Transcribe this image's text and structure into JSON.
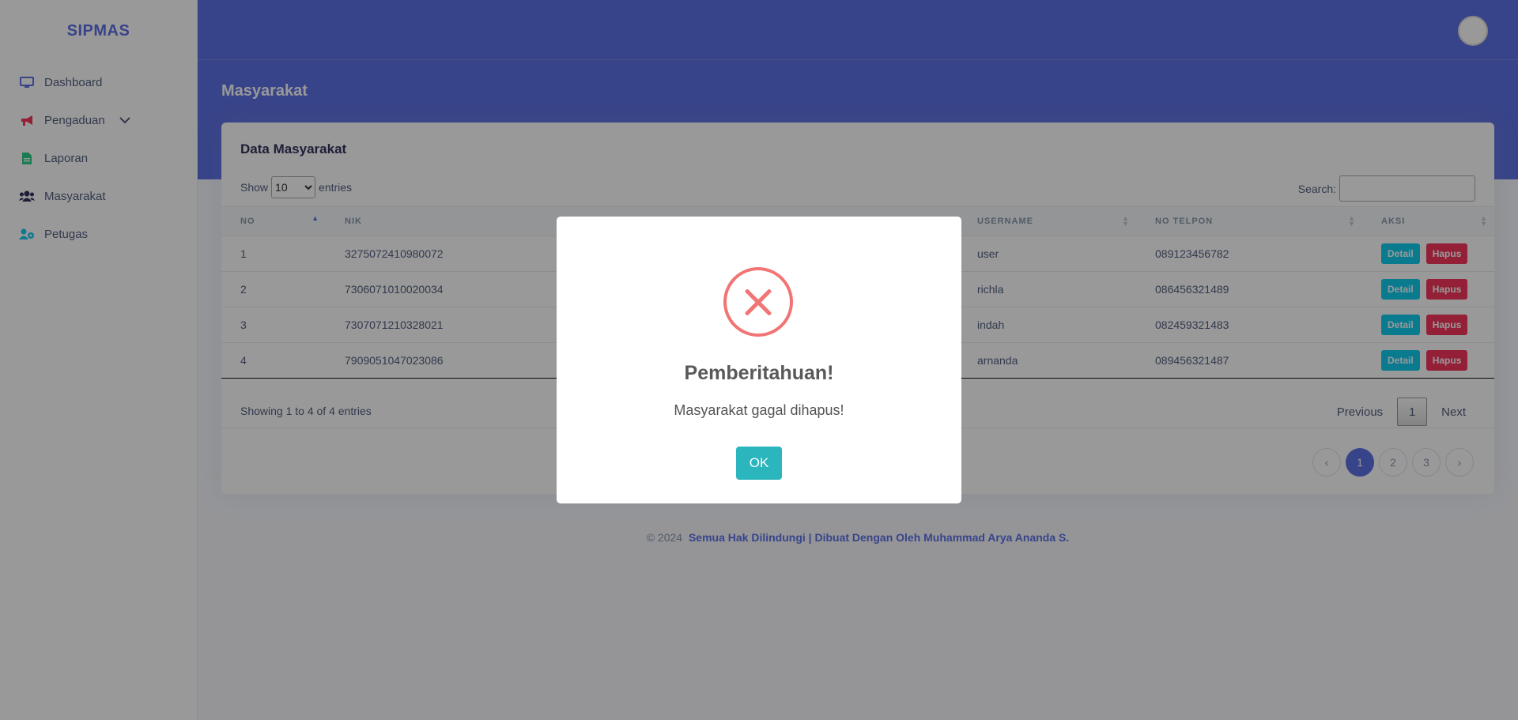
{
  "brand": "SIPMAS",
  "sidebar": {
    "items": [
      {
        "label": "Dashboard",
        "icon": "monitor-icon"
      },
      {
        "label": "Pengaduan",
        "icon": "megaphone-icon"
      },
      {
        "label": "Laporan",
        "icon": "document-icon"
      },
      {
        "label": "Masyarakat",
        "icon": "users-icon"
      },
      {
        "label": "Petugas",
        "icon": "users-cog-icon"
      }
    ]
  },
  "header": {
    "title": "Masyarakat"
  },
  "card": {
    "title": "Data Masyarakat",
    "show_label": "Show",
    "entries_label": "entries",
    "length_value": "10",
    "search_label": "Search:",
    "search_value": ""
  },
  "table": {
    "columns": [
      "NO",
      "NIK",
      "USERNAME",
      "NO TELPON",
      "AKSI"
    ],
    "rows": [
      {
        "no": "1",
        "nik": "3275072410980072",
        "username": "user",
        "telp": "089123456782"
      },
      {
        "no": "2",
        "nik": "7306071010020034",
        "username": "richla",
        "telp": "086456321489"
      },
      {
        "no": "3",
        "nik": "7307071210328021",
        "username": "indah",
        "telp": "082459321483"
      },
      {
        "no": "4",
        "nik": "7909051047023086",
        "username": "arnanda",
        "telp": "089456321487"
      }
    ],
    "detail_label": "Detail",
    "hapus_label": "Hapus",
    "info": "Showing 1 to 4 of 4 entries",
    "previous": "Previous",
    "next": "Next",
    "current_page": "1"
  },
  "pagination": {
    "prev": "‹",
    "pages": [
      "1",
      "2",
      "3"
    ],
    "next": "›"
  },
  "footer": {
    "copy": "© 2024",
    "credit": "Semua Hak Dilindungi | Dibuat Dengan Oleh Muhammad Arya Ananda S."
  },
  "modal": {
    "title": "Pemberitahuan!",
    "text": "Masyarakat gagal dihapus!",
    "ok": "OK"
  },
  "colors": {
    "primary": "#5e72e4",
    "info": "#11cdef",
    "danger": "#f5365c",
    "error_icon": "#f27474",
    "ok_button": "#2bb5bd"
  }
}
